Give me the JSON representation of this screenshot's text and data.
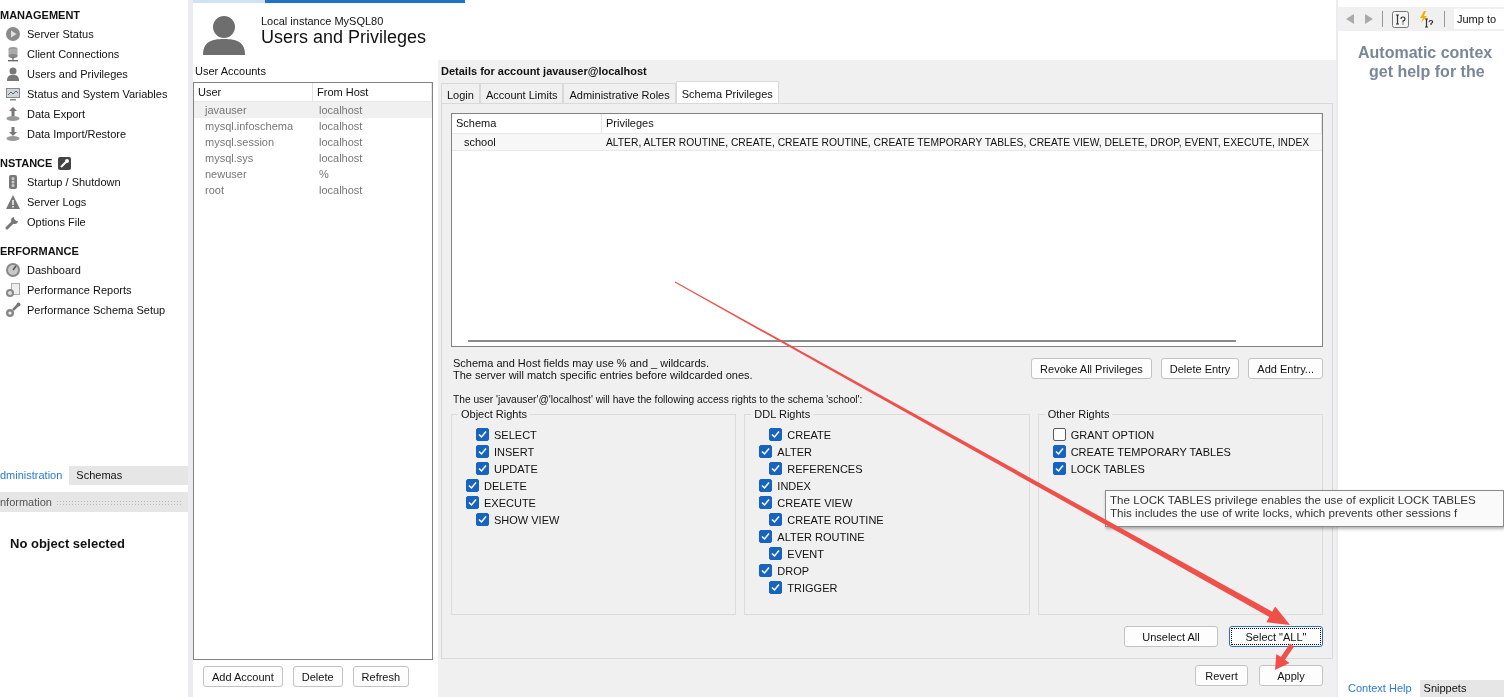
{
  "sidebar": {
    "sections": [
      {
        "title": "MANAGEMENT",
        "has_tool": false,
        "items": [
          "Server Status",
          "Client Connections",
          "Users and Privileges",
          "Status and System Variables",
          "Data Export",
          "Data Import/Restore"
        ]
      },
      {
        "title": "NSTANCE",
        "has_tool": true,
        "items": [
          "Startup / Shutdown",
          "Server Logs",
          "Options File"
        ]
      },
      {
        "title": "ERFORMANCE",
        "has_tool": false,
        "items": [
          "Dashboard",
          "Performance Reports",
          "Performance Schema Setup"
        ]
      }
    ],
    "tabs": [
      {
        "label": "dministration",
        "selected": true
      },
      {
        "label": "Schemas",
        "selected": false
      }
    ],
    "info_header": "nformation",
    "info_text": "No object selected"
  },
  "header": {
    "subtitle": "Local instance MySQL80",
    "title": "Users and Privileges"
  },
  "accounts": {
    "label": "User Accounts",
    "columns": [
      "User",
      "From Host"
    ],
    "rows": [
      {
        "user": "javauser",
        "host": "localhost",
        "selected": true
      },
      {
        "user": "mysql.infoschema",
        "host": "localhost",
        "selected": false
      },
      {
        "user": "mysql.session",
        "host": "localhost",
        "selected": false
      },
      {
        "user": "mysql.sys",
        "host": "localhost",
        "selected": false
      },
      {
        "user": "newuser",
        "host": "%",
        "selected": false
      },
      {
        "user": "root",
        "host": "localhost",
        "selected": false
      }
    ],
    "buttons": [
      "Add Account",
      "Delete",
      "Refresh"
    ]
  },
  "details": {
    "title": "Details for account javauser@localhost",
    "tabs": [
      {
        "label": "Login",
        "selected": false
      },
      {
        "label": "Account Limits",
        "selected": false
      },
      {
        "label": "Administrative Roles",
        "selected": false
      },
      {
        "label": "Schema Privileges",
        "selected": true
      }
    ],
    "schema_table": {
      "columns": [
        "Schema",
        "Privileges"
      ],
      "rows": [
        {
          "schema": "school",
          "privileges": "ALTER, ALTER ROUTINE, CREATE, CREATE ROUTINE, CREATE TEMPORARY TABLES, CREATE VIEW, DELETE, DROP, EVENT, EXECUTE, INDEX",
          "selected": true
        }
      ]
    },
    "notes": [
      "Schema and Host fields may use % and _ wildcards.",
      "The server will match specific entries before wildcarded ones."
    ],
    "entry_buttons": [
      "Revoke All Privileges",
      "Delete Entry",
      "Add Entry..."
    ],
    "access_text": "The user 'javauser'@'localhost' will have the following access rights to the schema 'school':",
    "groups": [
      {
        "title": "Object Rights",
        "rights": [
          {
            "label": "SELECT",
            "kind": "sub",
            "checked": true
          },
          {
            "label": "INSERT",
            "kind": "sub",
            "checked": true
          },
          {
            "label": "UPDATE",
            "kind": "sub",
            "checked": true
          },
          {
            "label": "DELETE",
            "kind": "main",
            "checked": true
          },
          {
            "label": "EXECUTE",
            "kind": "main",
            "checked": true
          },
          {
            "label": "SHOW VIEW",
            "kind": "sub",
            "checked": true
          }
        ]
      },
      {
        "title": "DDL Rights",
        "rights": [
          {
            "label": "CREATE",
            "kind": "sub",
            "checked": true
          },
          {
            "label": "ALTER",
            "kind": "main",
            "checked": true
          },
          {
            "label": "REFERENCES",
            "kind": "sub",
            "checked": true
          },
          {
            "label": "INDEX",
            "kind": "main",
            "checked": true
          },
          {
            "label": "CREATE VIEW",
            "kind": "main",
            "checked": true
          },
          {
            "label": "CREATE ROUTINE",
            "kind": "sub",
            "checked": true
          },
          {
            "label": "ALTER ROUTINE",
            "kind": "main",
            "checked": true
          },
          {
            "label": "EVENT",
            "kind": "sub",
            "checked": true
          },
          {
            "label": "DROP",
            "kind": "main",
            "checked": true
          },
          {
            "label": "TRIGGER",
            "kind": "sub",
            "checked": true
          }
        ]
      },
      {
        "title": "Other Rights",
        "rights": [
          {
            "label": "GRANT OPTION",
            "kind": "main",
            "checked": false
          },
          {
            "label": "CREATE TEMPORARY TABLES",
            "kind": "main",
            "checked": true
          },
          {
            "label": "LOCK TABLES",
            "kind": "main",
            "checked": true
          }
        ]
      }
    ],
    "select_buttons": [
      {
        "label": "Unselect All",
        "focused": false
      },
      {
        "label": "Select \"ALL\"",
        "focused": true
      }
    ]
  },
  "tooltip": {
    "lines": [
      "The LOCK TABLES privilege enables the use of explicit LOCK TABLES",
      "This includes the use of write locks, which prevents other sessions f"
    ]
  },
  "footer_buttons": [
    "Revert",
    "Apply"
  ],
  "help": {
    "jump_label": "Jump to",
    "message_lines": [
      "Automatic contex",
      "get help for the"
    ],
    "tabs": [
      {
        "label": "Context Help",
        "selected": true
      },
      {
        "label": "Snippets",
        "selected": false
      }
    ]
  }
}
